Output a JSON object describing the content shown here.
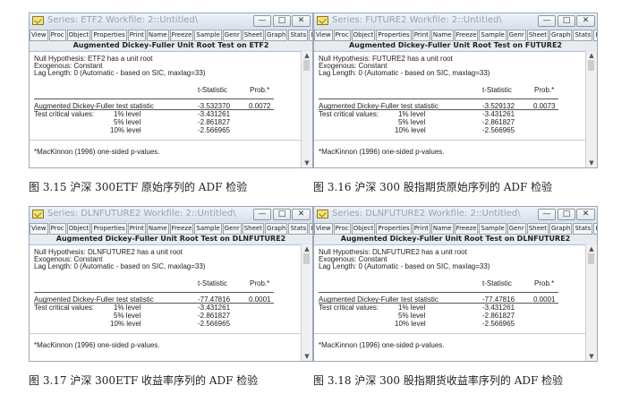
{
  "toolbar": [
    "View",
    "Proc",
    "Object",
    "Properties",
    "Print",
    "Name",
    "Freeze",
    "Sample",
    "Genr",
    "Sheet",
    "Graph",
    "Stats",
    "Ider"
  ],
  "window_buttons": {
    "minimize": "—",
    "maximize": "□",
    "close": "✕"
  },
  "common": {
    "exogenous": "Exogenous: Constant",
    "lag": "Lag Length: 0 (Automatic - based on SIC, maxlag=33)",
    "tstat": "t-Statistic",
    "prob": "Prob.*",
    "adf_label": "Augmented Dickey-Fuller test statistic",
    "crit_label": "Test critical values:",
    "l1": "1% level",
    "l5": "5% level",
    "l10": "10% level",
    "c1": "-3.431261",
    "c5": "-2.861827",
    "c10": "-2.566965",
    "footnote": "*MacKinnon (1996) one-sided p-values."
  },
  "panels": [
    {
      "title": "Series: ETF2   Workfile: 2::Untitled\\",
      "header": "Augmented Dickey-Fuller Unit Root Test on ETF2",
      "null": "Null Hypothesis: ETF2 has a unit root",
      "tvalue": "-3.532370",
      "pvalue": "0.0072",
      "caption": "图 3.15 沪深 300ETF 原始序列的 ADF 检验"
    },
    {
      "title": "Series: FUTURE2   Workfile: 2::Untitled\\",
      "header": "Augmented Dickey-Fuller Unit Root Test on FUTURE2",
      "null": "Null Hypothesis: FUTURE2 has a unit root",
      "tvalue": "-3.529132",
      "pvalue": "0.0073",
      "caption": "图 3.16 沪深 300 股指期货原始序列的 ADF 检验"
    },
    {
      "title": "Series: DLNFUTURE2   Workfile: 2::Untitled\\",
      "header": "Augmented Dickey-Fuller Unit Root Test on DLNFUTURE2",
      "null": "Null Hypothesis: DLNFUTURE2 has a unit root",
      "tvalue": "-77.47816",
      "pvalue": "0.0001",
      "caption": "图 3.17 沪深 300ETF 收益率序列的 ADF 检验"
    },
    {
      "title": "Series: DLNFUTURE2   Workfile: 2::Untitled\\",
      "header": "Augmented Dickey-Fuller Unit Root Test on DLNFUTURE2",
      "null": "Null Hypothesis: DLNFUTURE2 has a unit root",
      "tvalue": "-77.47816",
      "pvalue": "0.0001",
      "caption": "图 3.18 沪深 300 股指期货收益率序列的 ADF 检验"
    }
  ]
}
